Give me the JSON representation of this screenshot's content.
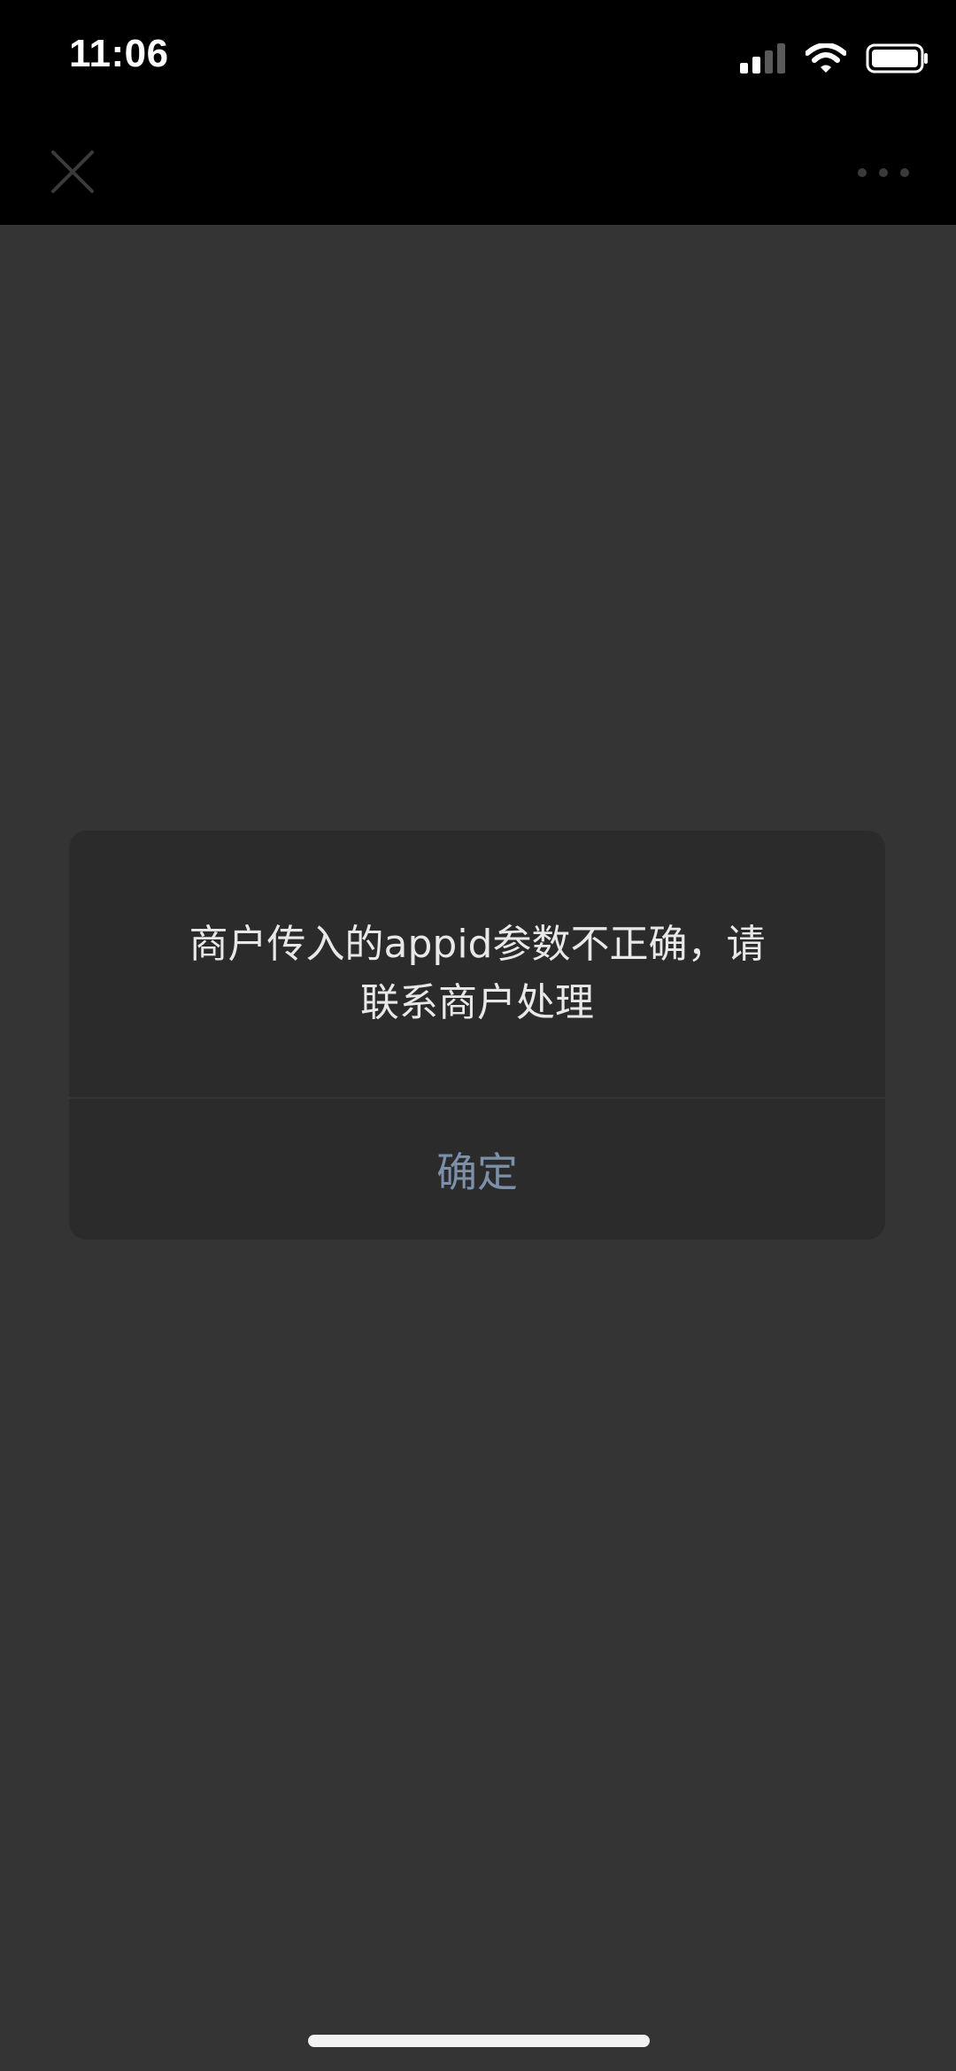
{
  "status_bar": {
    "time": "11:06",
    "icons": [
      "cellular-signal-icon",
      "wifi-icon",
      "battery-icon"
    ]
  },
  "nav_bar": {
    "close_icon": "close-icon",
    "more_icon": "more-icon"
  },
  "dialog": {
    "message_line1": "商户传入的appid参数不正确，请",
    "message_line2": "联系商户处理",
    "confirm_label": "确定"
  },
  "colors": {
    "background": "#343434",
    "bars": "#000000",
    "dialog": "#2b2b2b",
    "message_text": "#e8e8e8",
    "button_text": "#7d90a9"
  }
}
